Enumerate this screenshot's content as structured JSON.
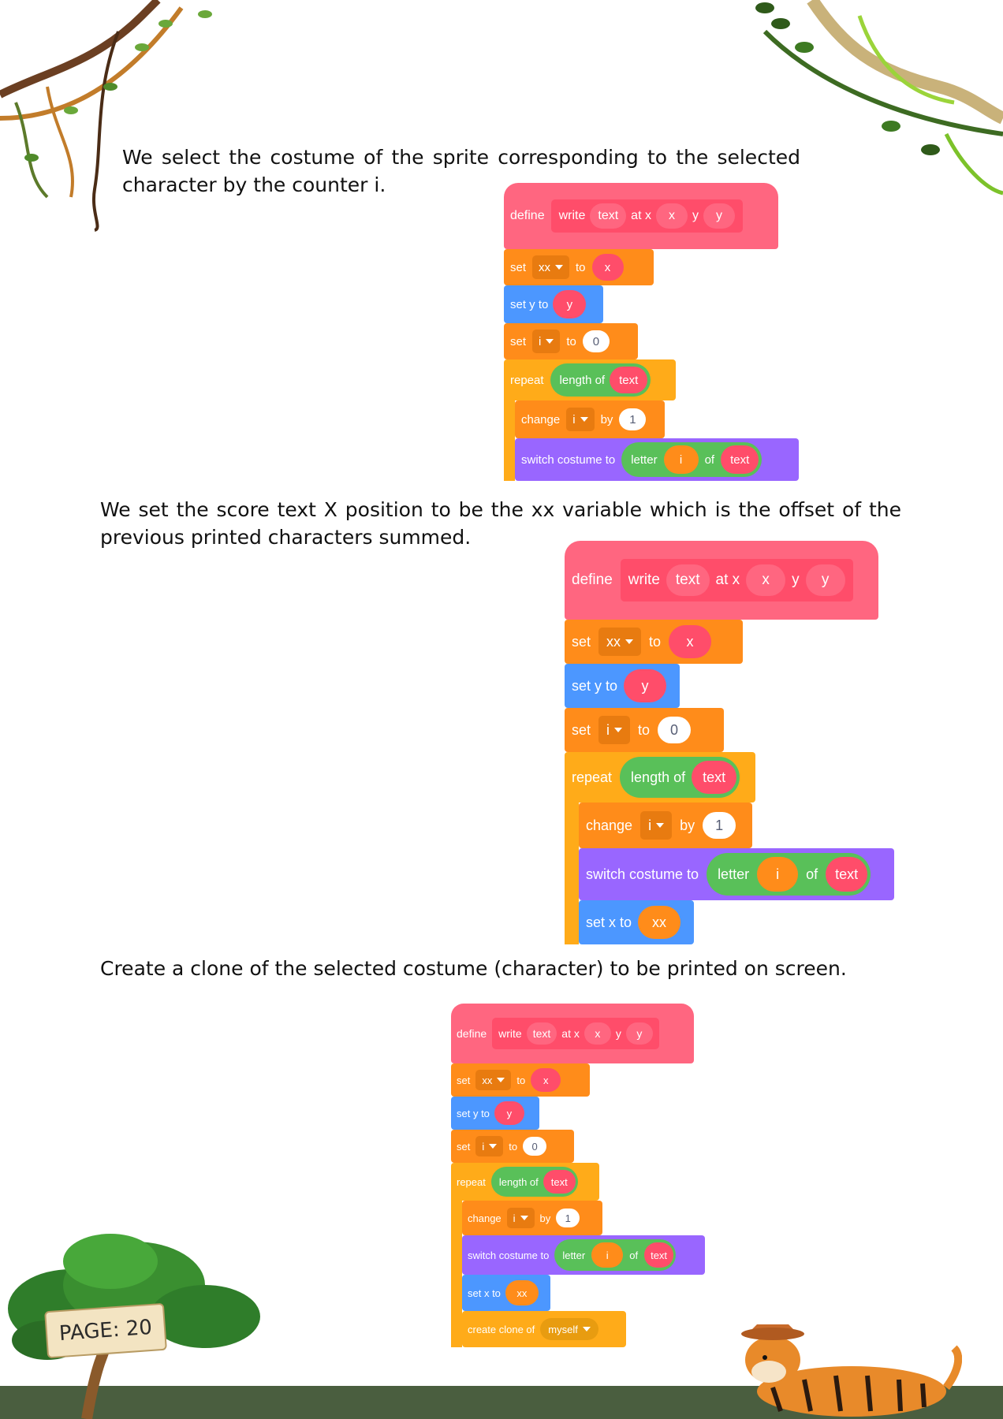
{
  "paragraphs": [
    "We select the costume of the sprite corresponding to the selected character by the counter i.",
    "We set the score text X position to be the xx variable which is the offset of the previous printed characters summed.",
    "Create a clone of the selected costume (character) to be printed on screen."
  ],
  "page_label": "PAGE: 20",
  "colors": {
    "my_blocks": "#ff6680",
    "my_blocks_inner": "#ff4d6a",
    "variables": "#ff8c1a",
    "motion": "#4c97ff",
    "control": "#ffab19",
    "operators": "#59c059",
    "looks": "#9966ff",
    "ground": "#4a5e3f"
  },
  "blocks": {
    "define": "define",
    "write": "write",
    "text": "text",
    "at_x": "at x",
    "x": "x",
    "y_label": "y",
    "y": "y",
    "set": "set",
    "xx": "xx",
    "to": "to",
    "set_y_to": "set y to",
    "i": "i",
    "zero": "0",
    "repeat": "repeat",
    "length_of": "length of",
    "change": "change",
    "by": "by",
    "one": "1",
    "switch_costume_to": "switch costume to",
    "letter": "letter",
    "of": "of",
    "set_x_to": "set x to",
    "create_clone_of": "create clone of",
    "myself": "myself"
  }
}
